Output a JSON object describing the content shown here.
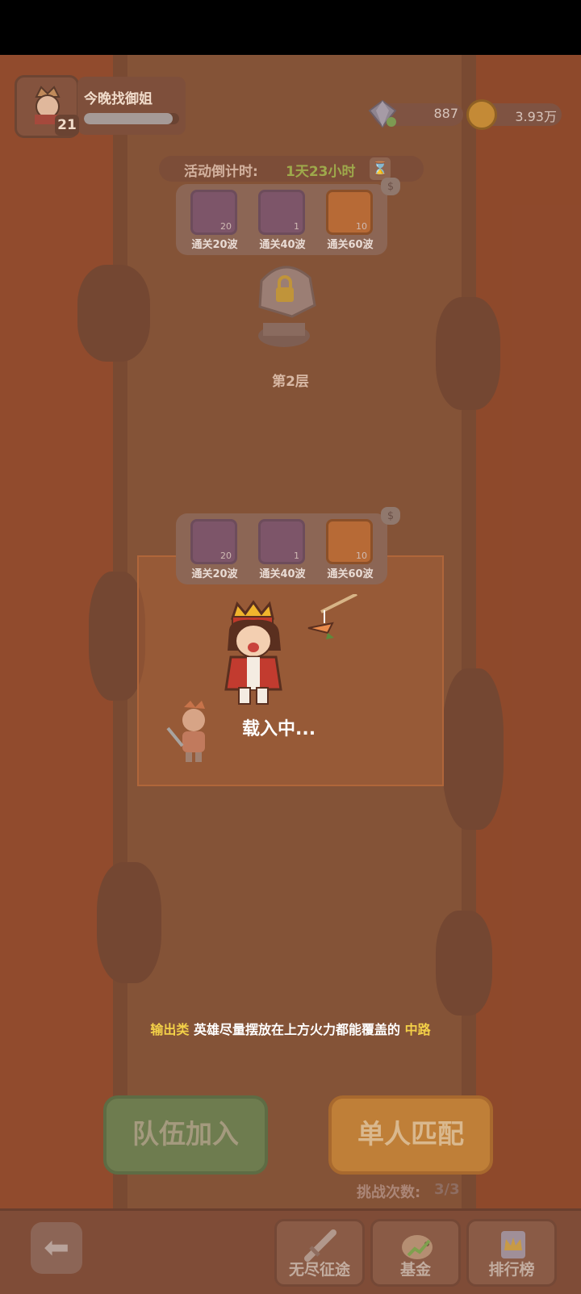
{
  "player": {
    "name": "今晚找御姐",
    "level": "21",
    "exp_fraction": 0.93
  },
  "currency": {
    "gems": "887",
    "coins": "3.93万"
  },
  "event": {
    "countdown_label": "活动倒计时:",
    "countdown_value": "1天23小时"
  },
  "floors": [
    {
      "label": "第2层",
      "rewards": [
        {
          "item": "gem",
          "count": "20",
          "label": "通关20波"
        },
        {
          "item": "potion",
          "count": "1",
          "label": "通关40波"
        },
        {
          "item": "cheese-bag",
          "count": "10",
          "label": "通关60波"
        }
      ]
    },
    {
      "rewards": [
        {
          "item": "gem",
          "count": "20",
          "label": "通关20波"
        },
        {
          "item": "potion",
          "count": "1",
          "label": "通关40波"
        },
        {
          "item": "cheese-bag",
          "count": "10",
          "label": "通关60波"
        }
      ]
    }
  ],
  "loading": {
    "text": "载入中..."
  },
  "hint": {
    "part1": "输出类",
    "part2": " 英雄尽量摆放在上方火力都能覆盖的 ",
    "part3": "中路"
  },
  "buttons": {
    "team": "队伍加入",
    "solo": "单人匹配"
  },
  "challenge": {
    "label": "挑战次数:",
    "count": "3/3"
  },
  "nav": {
    "endless": "无尽征途",
    "fund": "基金",
    "ranking": "排行榜"
  },
  "icons": {
    "back": "back-arrow-icon",
    "hourglass": "hourglass-icon",
    "bag": "money-bag-icon"
  },
  "colors": {
    "lava": "#9c4f30",
    "path": "#7b5238",
    "hint_highlight": "#f3d048",
    "team_button": "#6e7c4f",
    "solo_button": "#bf7f38"
  }
}
